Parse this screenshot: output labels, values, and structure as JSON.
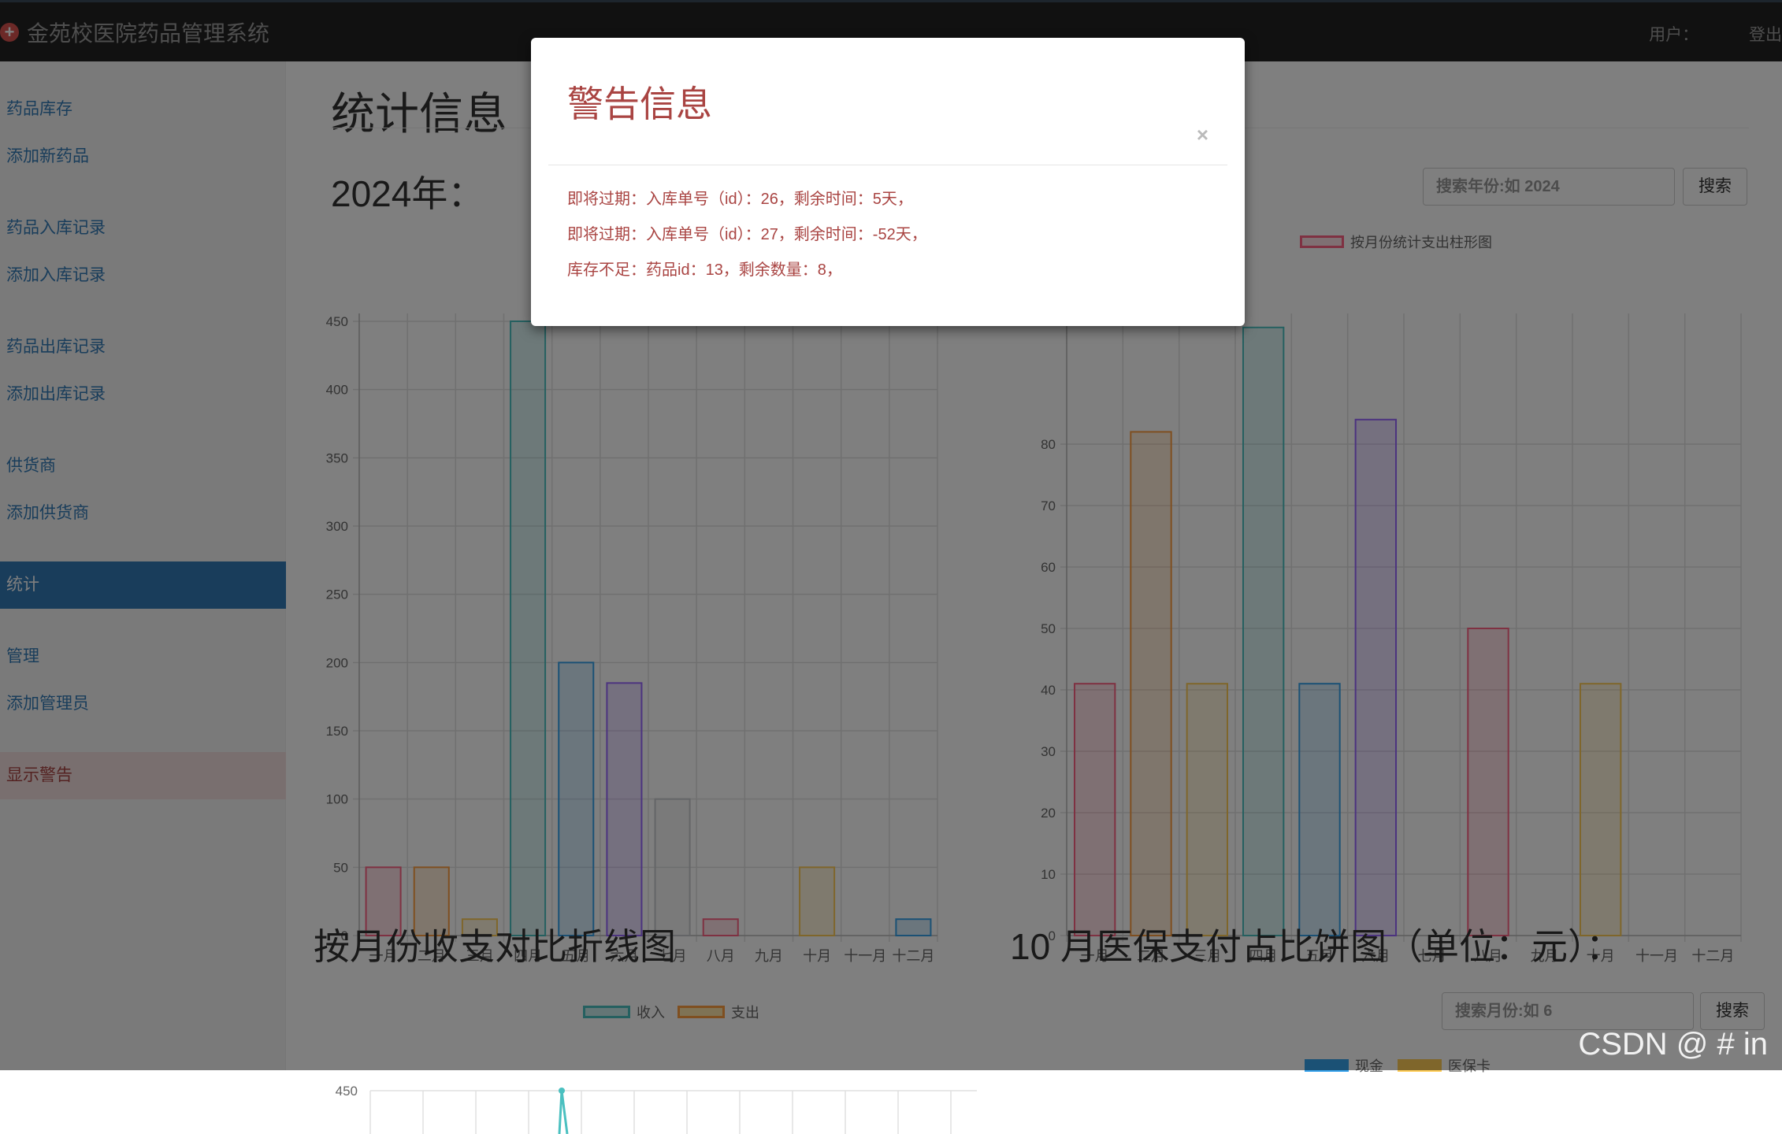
{
  "app": {
    "title": "金苑校医院药品管理系统",
    "user_label": "用户：",
    "logout": "登出"
  },
  "sidebar": {
    "items": [
      {
        "label": "药品库存"
      },
      {
        "label": "添加新药品"
      },
      {
        "label": "药品入库记录"
      },
      {
        "label": "添加入库记录"
      },
      {
        "label": "药品出库记录"
      },
      {
        "label": "添加出库记录"
      },
      {
        "label": "供货商"
      },
      {
        "label": "添加供货商"
      },
      {
        "label": "统计"
      },
      {
        "label": "管理"
      },
      {
        "label": "添加管理员"
      },
      {
        "label": "显示警告"
      }
    ]
  },
  "main": {
    "title": "统计信息",
    "year_heading": "2024年：",
    "year_search": {
      "placeholder": "搜索年份:如 2024",
      "button": "搜索"
    },
    "line_heading": "按月份收支对比折线图",
    "pie_heading": "10 月医保支付占比饼图（单位：元）：",
    "month_search": {
      "placeholder": "搜索月份:如 6",
      "button": "搜索"
    }
  },
  "colors": {
    "palette": [
      "#ff6384",
      "#ff9f40",
      "#ffcd56",
      "#4bc0c0",
      "#36a2eb",
      "#9966ff",
      "#c9cbcf"
    ]
  },
  "chart_data": [
    {
      "type": "bar",
      "categories": [
        "一月",
        "二月",
        "三月",
        "四月",
        "五月",
        "六月",
        "七月",
        "八月",
        "九月",
        "十月",
        "十一月",
        "十二月"
      ],
      "values": [
        50,
        50,
        12,
        450,
        200,
        185,
        100,
        12,
        0,
        50,
        0,
        12
      ],
      "ylim": [
        0,
        450
      ],
      "yticks": [
        0,
        50,
        100,
        150,
        200,
        250,
        300,
        350,
        400,
        450
      ],
      "grid": true
    },
    {
      "type": "bar",
      "categories": [
        "一月",
        "二月",
        "三月",
        "四月",
        "五月",
        "六月",
        "七月",
        "八月",
        "九月",
        "十月",
        "十一月",
        "十二月"
      ],
      "series": [
        {
          "name": "按月份统计支出柱形图",
          "values": [
            41,
            82,
            41,
            99,
            41,
            84,
            0,
            50,
            0,
            41,
            0,
            0
          ]
        }
      ],
      "ylim": [
        0,
        100
      ],
      "yticks": [
        0,
        10,
        20,
        30,
        40,
        50,
        60,
        70,
        80
      ],
      "legend": "top",
      "grid": true
    },
    {
      "type": "line",
      "series": [
        {
          "name": "收入"
        },
        {
          "name": "支出"
        }
      ],
      "yticks": [
        450
      ],
      "legend": "top"
    },
    {
      "type": "pie",
      "series": [
        {
          "name": "现金"
        },
        {
          "name": "医保卡"
        }
      ],
      "legend": "top"
    }
  ],
  "modal": {
    "title": "警告信息",
    "close": "×",
    "lines": [
      "即将过期：入库单号（id）：26，剩余时间：5天，",
      "即将过期：入库单号（id）：27，剩余时间：-52天，",
      "库存不足：药品id：13，剩余数量：8，"
    ]
  },
  "watermark": "CSDN @ # in"
}
